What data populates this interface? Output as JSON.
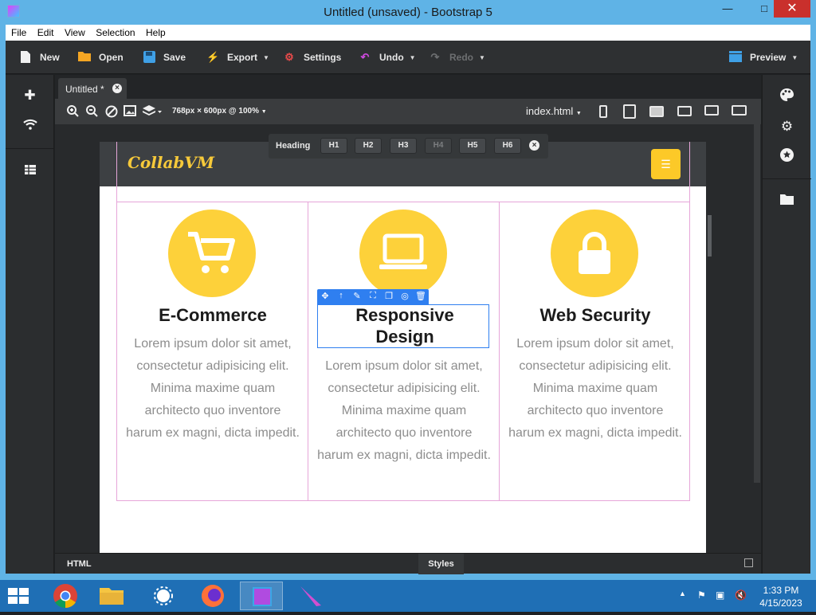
{
  "window": {
    "title": "Untitled (unsaved) - Bootstrap 5",
    "minimize": "—",
    "maximize": "□",
    "close": "✕"
  },
  "menu": [
    "File",
    "Edit",
    "View",
    "Selection",
    "Help"
  ],
  "toolbar": {
    "new": "New",
    "open": "Open",
    "save": "Save",
    "export": "Export",
    "settings": "Settings",
    "undo": "Undo",
    "redo": "Redo",
    "preview": "Preview"
  },
  "tab": {
    "label": "Untitled *"
  },
  "viewport": {
    "size_label": "768px × 600px @ 100%",
    "file": "index.html"
  },
  "heading_toolbar": {
    "label": "Heading",
    "levels": [
      "H1",
      "H2",
      "H3",
      "H4",
      "H5",
      "H6"
    ],
    "disabled_level": "H4"
  },
  "page": {
    "brand": "CollabVM",
    "features": [
      {
        "title": "E-Commerce",
        "icon": "cart-icon",
        "text": "Lorem ipsum dolor sit amet, consectetur adipisicing elit. Minima maxime quam architecto quo inventore harum ex magni, dicta impedit."
      },
      {
        "title": "Responsive Design",
        "icon": "laptop-icon",
        "text": "Lorem ipsum dolor sit amet, consectetur adipisicing elit. Minima maxime quam architecto quo inventore harum ex magni, dicta impedit."
      },
      {
        "title": "Web Security",
        "icon": "lock-icon",
        "text": "Lorem ipsum dolor sit amet, consectetur adipisicing elit. Minima maxime quam architecto quo inventore harum ex magni, dicta impedit."
      }
    ],
    "accent_color": "#fdd13a"
  },
  "bottom": {
    "html": "HTML",
    "styles": "Styles"
  },
  "taskbar": {
    "time": "1:33 PM",
    "date": "4/15/2023"
  }
}
